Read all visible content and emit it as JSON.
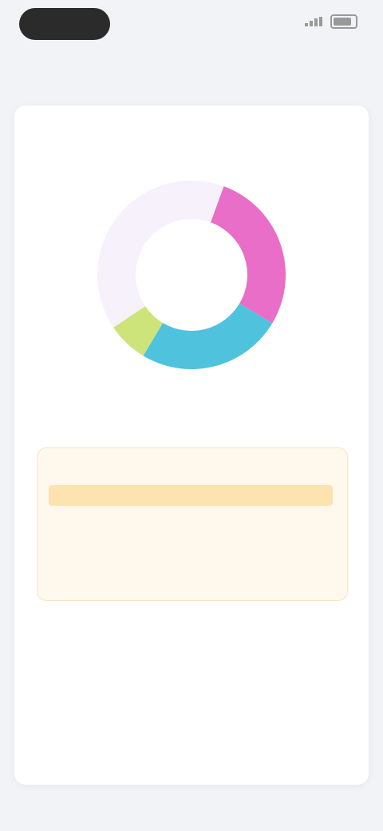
{
  "status_bar": {
    "time": ""
  },
  "nav": {
    "title": ""
  },
  "summary": {
    "heading": "",
    "chart_top_label": "",
    "center_value": "",
    "center_label": "",
    "caption": ""
  },
  "chart_data": {
    "type": "pie",
    "categories": [
      "",
      "",
      "",
      ""
    ],
    "values": [
      28,
      25,
      7,
      40
    ],
    "colors": [
      "#e86ec8",
      "#4fc2de",
      "#cde47a",
      "#f6f1fb"
    ],
    "title": ""
  },
  "warning": {
    "title": "",
    "highlight": "",
    "body": ""
  },
  "notes": [
    {
      "label": "",
      "text": ""
    },
    {
      "label": "",
      "text": ""
    }
  ],
  "link": {
    "label": ""
  },
  "next_section": {
    "heading": ""
  },
  "colors": {
    "background": "#f2f3f6",
    "card": "#ffffff",
    "warning_bg": "#fff8ec",
    "warning_highlight": "#fde3b0",
    "link": "#7a6cf0"
  }
}
